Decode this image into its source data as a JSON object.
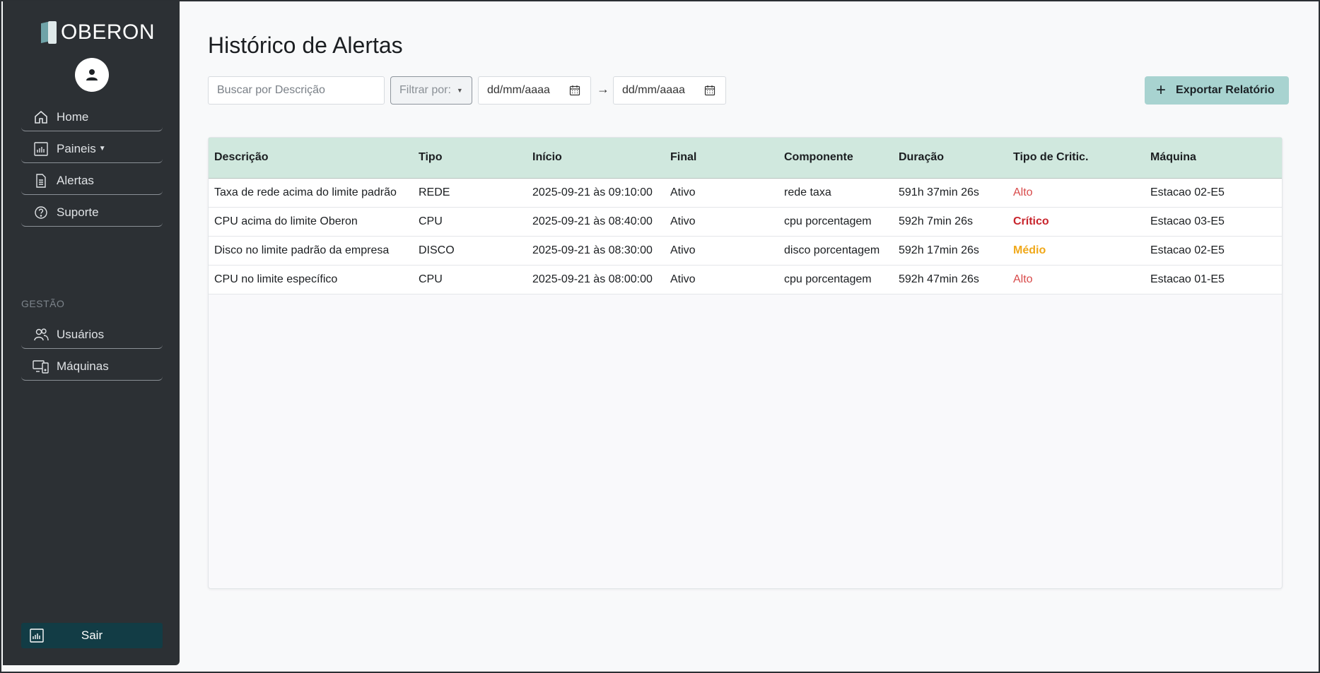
{
  "brand": {
    "name": "OBERON"
  },
  "sidebar": {
    "items": [
      {
        "label": "Home",
        "icon": "home-icon"
      },
      {
        "label": "Paineis",
        "icon": "chart-icon",
        "dropdown": true
      },
      {
        "label": "Alertas",
        "icon": "document-icon"
      },
      {
        "label": "Suporte",
        "icon": "help-icon"
      }
    ],
    "section_label": "GESTÃO",
    "gestao_items": [
      {
        "label": "Usuários",
        "icon": "users-icon"
      },
      {
        "label": "Máquinas",
        "icon": "devices-icon"
      }
    ],
    "logout_label": "Sair"
  },
  "page": {
    "title": "Histórico de Alertas"
  },
  "toolbar": {
    "search_placeholder": "Buscar por Descrição",
    "filter_label": "Filtrar por:",
    "date_from": "dd/mm/aaaa",
    "date_to": "dd/mm/aaaa",
    "export_label": "Exportar Relatório"
  },
  "table": {
    "columns": [
      "Descrição",
      "Tipo",
      "Início",
      "Final",
      "Componente",
      "Duração",
      "Tipo de Critic.",
      "Máquina"
    ],
    "rows": [
      {
        "descricao": "Taxa de rede acima do limite padrão",
        "tipo": "REDE",
        "inicio": "2025-09-21 às 09:10:00",
        "final": "Ativo",
        "componente": "rede taxa",
        "duracao": "591h 37min 26s",
        "criticidade": "Alto",
        "maquina": "Estacao 02-E5"
      },
      {
        "descricao": "CPU acima do limite Oberon",
        "tipo": "CPU",
        "inicio": "2025-09-21 às 08:40:00",
        "final": "Ativo",
        "componente": "cpu porcentagem",
        "duracao": "592h 7min 26s",
        "criticidade": "Crítico",
        "maquina": "Estacao 03-E5"
      },
      {
        "descricao": "Disco no limite padrão da empresa",
        "tipo": "DISCO",
        "inicio": "2025-09-21 às 08:30:00",
        "final": "Ativo",
        "componente": "disco porcentagem",
        "duracao": "592h 17min 26s",
        "criticidade": "Médio",
        "maquina": "Estacao 02-E5"
      },
      {
        "descricao": "CPU no limite específico",
        "tipo": "CPU",
        "inicio": "2025-09-21 às 08:00:00",
        "final": "Ativo",
        "componente": "cpu porcentagem",
        "duracao": "592h 47min 26s",
        "criticidade": "Alto",
        "maquina": "Estacao 01-E5"
      }
    ]
  },
  "colors": {
    "sidebar_bg": "#2c3034",
    "header_row_bg": "#d0e8de",
    "export_button_bg": "#a8d3d0",
    "logout_bg": "#123c45",
    "crit_alto": "#d84a4a",
    "crit_critico": "#c8242c",
    "crit_medio": "#f0a81a"
  }
}
